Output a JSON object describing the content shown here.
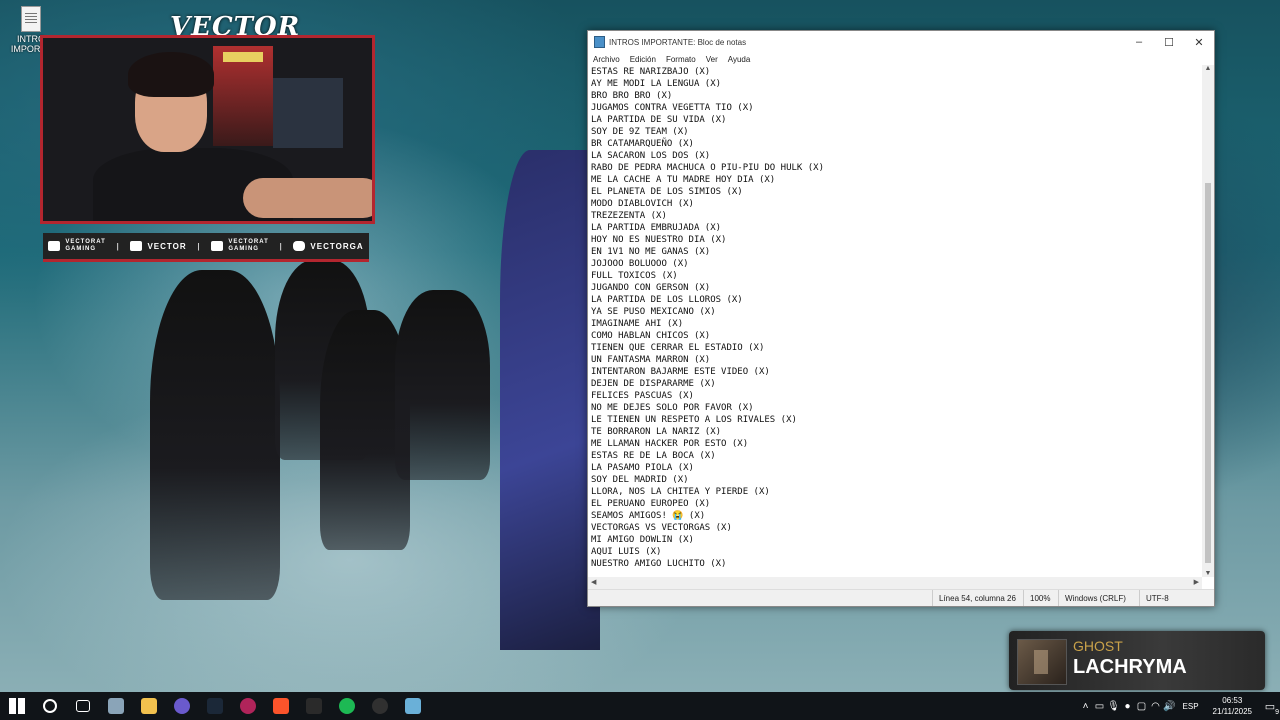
{
  "desktop": {
    "icon_label": "INTRO\nIMPORTA"
  },
  "overlay": {
    "brand": "VECTOR",
    "socials": [
      {
        "icon": "youtube-icon",
        "label": "VECTORAT\nGAMING"
      },
      {
        "icon": "twitch-icon",
        "label": "VECTOR"
      },
      {
        "icon": "twitter-icon",
        "label": "VECTORAT\nGAMING"
      },
      {
        "icon": "instagram-icon",
        "label": "VECTORGA"
      }
    ],
    "accent_color": "#b3262f"
  },
  "notepad": {
    "title": "INTROS IMPORTANTE: Bloc de notas",
    "menu": [
      "Archivo",
      "Edición",
      "Formato",
      "Ver",
      "Ayuda"
    ],
    "lines": [
      "ESTAS RE NARIZBAJO (X)",
      "AY ME MODI LA LENGUA (X)",
      "BRO BRO BRO (X)",
      "JUGAMOS CONTRA VEGETTA TIO (X)",
      "LA PARTIDA DE SU VIDA (X)",
      "SOY DE 9Z TEAM (X)",
      "BR CATAMARQUEÑO (X)",
      "LA SACARON LOS DOS (X)",
      "RABO DE PEDRA MACHUCA O PIU-PIU DO HULK (X)",
      "ME LA CACHE A TU MADRE HOY DIA (X)",
      "EL PLANETA DE LOS SIMIOS (X)",
      "MODO DIABLOVICH (X)",
      "TREZEZENTA (X)",
      "LA PARTIDA EMBRUJADA (X)",
      "HOY NO ES NUESTRO DIA (X)",
      "EN 1V1 NO ME GANAS (X)",
      "JOJOOO BOLUOOO (X)",
      "FULL TOXICOS (X)",
      "JUGANDO CON GERSON (X)",
      "LA PARTIDA DE LOS LLOROS (X)",
      "YA SE PUSO MEXICANO (X)",
      "IMAGINAME AHI (X)",
      "COMO HABLAN CHICOS (X)",
      "TIENEN QUE CERRAR EL ESTADIO (X)",
      "UN FANTASMA MARRON (X)",
      "INTENTARON BAJARME ESTE VIDEO (X)",
      "DEJEN DE DISPARARME (X)",
      "FELICES PASCUAS (X)",
      "NO ME DEJES SOLO POR FAVOR (X)",
      "LE TIENEN UN RESPETO A LOS RIVALES (X)",
      "TE BORRARON LA NARIZ (X)",
      "ME LLAMAN HACKER POR ESTO (X)",
      "ESTAS RE DE LA BOCA (X)",
      "LA PASAMO PIOLA (X)",
      "SOY DEL MADRID (X)",
      "LLORA, NOS LA CHITEA Y PIERDE (X)",
      "EL PERUANO EUROPEO (X)",
      "SEAMOS AMIGOS! 😭 (X)",
      "VECTORGAS VS VECTORGAS (X)",
      "MI AMIGO DOWLIN (X)",
      "AQUI LUIS (X)",
      "NUESTRO AMIGO LUCHITO (X)"
    ],
    "status": {
      "position": "Línea 54, columna 26",
      "zoom": "100%",
      "line_ending": "Windows (CRLF)",
      "encoding": "UTF-8"
    }
  },
  "now_playing": {
    "artist": "GHOST",
    "track": "LACHRYMA"
  },
  "taskbar": {
    "apps": [
      {
        "name": "start-button",
        "color": "#ffffff"
      },
      {
        "name": "search-button",
        "color": "#ffffff"
      },
      {
        "name": "task-view-button",
        "color": "#ffffff"
      },
      {
        "name": "app-window-icon",
        "color": "#8aa4b8"
      },
      {
        "name": "file-explorer-icon",
        "color": "#f2c14e"
      },
      {
        "name": "discord-icon",
        "color": "#6a5acd"
      },
      {
        "name": "steam-icon",
        "color": "#1b2838"
      },
      {
        "name": "obs-icon",
        "color": "#b0245a"
      },
      {
        "name": "brave-icon",
        "color": "#fb542b"
      },
      {
        "name": "game-launcher-icon",
        "color": "#2a2a2a"
      },
      {
        "name": "spotify-icon",
        "color": "#1db954"
      },
      {
        "name": "obs-studio-icon",
        "color": "#303030"
      },
      {
        "name": "notepad-icon",
        "color": "#6ab0d8"
      }
    ],
    "language": "ESP",
    "time": "06:53",
    "date": "21/11/2025",
    "notification_count": "9"
  }
}
